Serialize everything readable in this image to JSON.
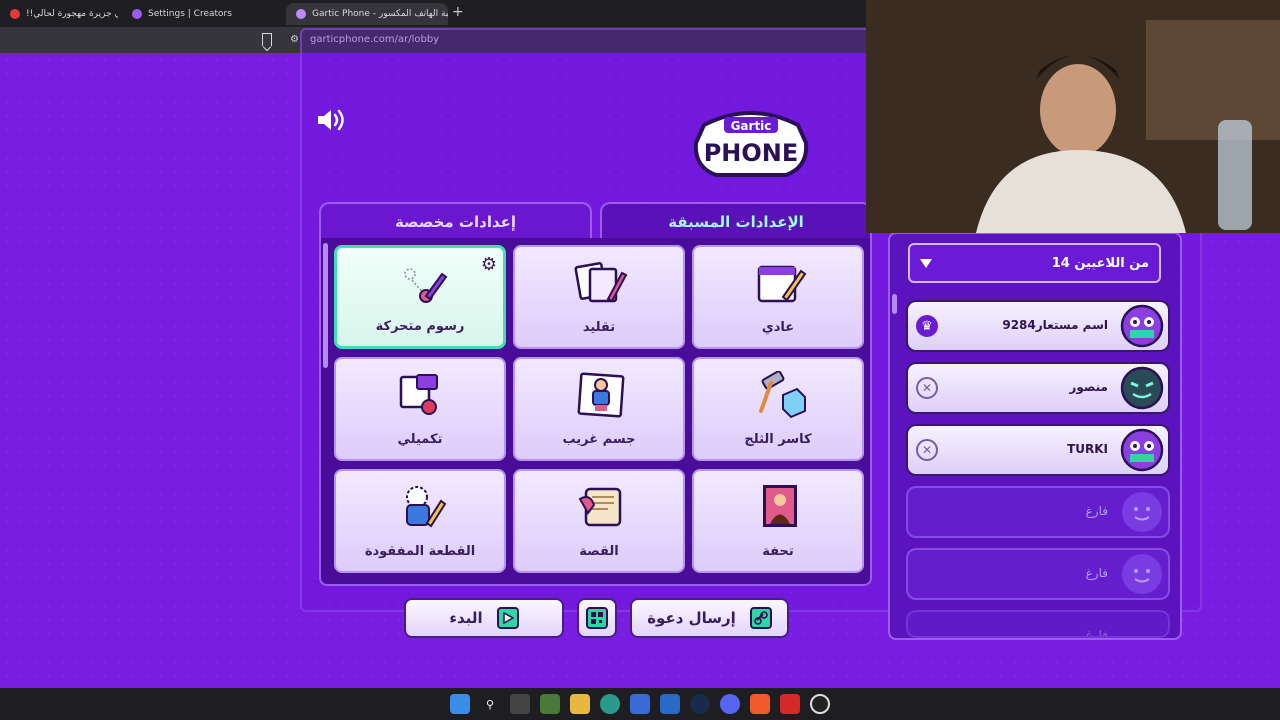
{
  "browser": {
    "tabs": [
      {
        "title": "عشت في جزيرة مهجورة لحالي!!",
        "active": false,
        "favicon_color": "#e03a3a"
      },
      {
        "title": "Settings | Creators",
        "active": false,
        "favicon_color": "#9b5cf0"
      },
      {
        "title": "Gartic Phone - لعبة الهاتف المكسور",
        "active": true,
        "favicon_color": "#c08af5"
      }
    ],
    "new_tab": "+",
    "url": "garticphone.com/ar/lobby"
  },
  "game": {
    "logo_top": "Gartic",
    "logo_bottom": "PHONE",
    "tabs": {
      "custom": "إعدادات مخصصة",
      "preset": "الإعدادات المسبقة"
    },
    "modes": [
      {
        "label": "عادي",
        "icon": "calendar-pencil-icon"
      },
      {
        "label": "تقليد",
        "icon": "cards-icon"
      },
      {
        "label": "رسوم متحركة",
        "icon": "animation-icon",
        "selected": true
      },
      {
        "label": "كاسر الثلج",
        "icon": "ice-hammer-icon"
      },
      {
        "label": "جسم غريب",
        "icon": "strange-body-icon"
      },
      {
        "label": "تكميلي",
        "icon": "puzzle-icon"
      },
      {
        "label": "تحفة",
        "icon": "masterpiece-icon"
      },
      {
        "label": "القصة",
        "icon": "scroll-icon"
      },
      {
        "label": "القطعة المفقودة",
        "icon": "missing-piece-icon"
      }
    ],
    "buttons": {
      "start": "البدء",
      "invite": "إرسال دعوة"
    },
    "players_count": "14 من اللاعبين",
    "players": [
      {
        "name": "اسم مستعار9284",
        "badge": "crown",
        "avatar_color": "#8b3fe0"
      },
      {
        "name": "منصور",
        "badge": "kick",
        "avatar_color": "#2a4a55"
      },
      {
        "name": "TURKI",
        "badge": "kick",
        "avatar_color": "#8b3fe0"
      },
      {
        "name": "فارغ",
        "badge": "none",
        "avatar_color": "#8a4ef0"
      },
      {
        "name": "فارغ",
        "badge": "none",
        "avatar_color": "#8a4ef0"
      },
      {
        "name": "فارغ",
        "badge": "none",
        "avatar_color": "#8a4ef0"
      }
    ]
  },
  "taskbar": {
    "icons": [
      "windows-icon",
      "search-icon",
      "taskview-icon",
      "widgets-icon",
      "explorer-icon",
      "edge-icon",
      "store-icon",
      "mail-icon",
      "steam-icon",
      "discord-icon",
      "brave-icon",
      "app-icon",
      "obs-icon"
    ]
  },
  "colors": {
    "accent_teal": "#2fd6a4",
    "page_purple": "#7a1de3",
    "preset_tab_text": "#9dfbe8"
  }
}
